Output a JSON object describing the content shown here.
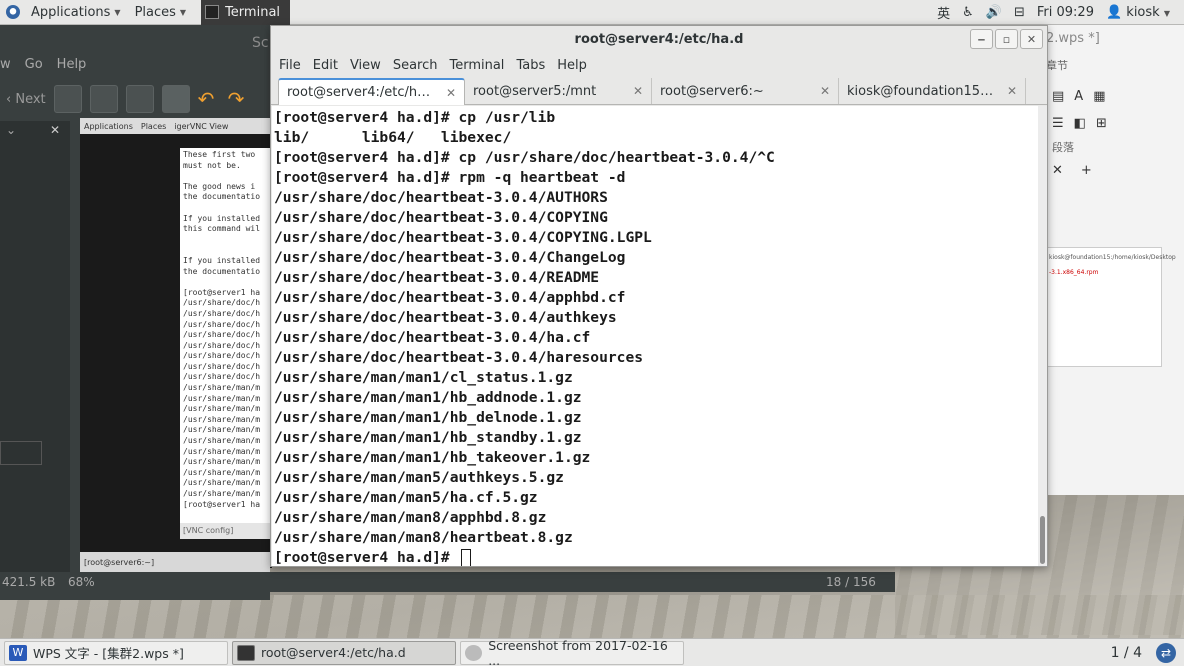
{
  "topbar": {
    "applications": "Applications",
    "places": "Places",
    "terminal_tab": "Terminal",
    "ime": "英",
    "clock": "Fri 09:29",
    "user": "kiosk"
  },
  "background_left": {
    "title": "Sc",
    "menu": [
      "w",
      "Go",
      "Help"
    ],
    "toolbar_next": "Next",
    "file_size": "421.5 kB",
    "zoom": "68%",
    "page": "18 / 156",
    "vnc_bar": [
      "Applications",
      "Places",
      "igerVNC View"
    ],
    "vnc_doc_lines": [
      "These first two",
      "must not be.",
      "",
      "The good news i",
      "the documentatio",
      "",
      "If you installed",
      "this command wil",
      "",
      "",
      "If you installed",
      "the documentatio",
      "",
      "[root@server1 ha",
      "/usr/share/doc/h",
      "/usr/share/doc/h",
      "/usr/share/doc/h",
      "/usr/share/doc/h",
      "/usr/share/doc/h",
      "/usr/share/doc/h",
      "/usr/share/doc/h",
      "/usr/share/doc/h",
      "/usr/share/man/m",
      "/usr/share/man/m",
      "/usr/share/man/m",
      "/usr/share/man/m",
      "/usr/share/man/m",
      "/usr/share/man/m",
      "/usr/share/man/m",
      "/usr/share/man/m",
      "/usr/share/man/m",
      "/usr/share/man/m",
      "/usr/share/man/m",
      "[root@server1 ha"
    ],
    "vnc_config": "[VNC config]",
    "vnc_task": "[root@server6:~]"
  },
  "background_right": {
    "title": "2.wps *]",
    "section": "章节",
    "para": "段落",
    "mini_title": "kiosk@foundation15:/home/kiosk/Desktop",
    "mini_text": "-3.1.x86_64.rpm"
  },
  "terminal": {
    "title": "root@server4:/etc/ha.d",
    "menu": [
      "File",
      "Edit",
      "View",
      "Search",
      "Terminal",
      "Tabs",
      "Help"
    ],
    "tabs": [
      {
        "label": "root@server4:/etc/ha.d",
        "active": true
      },
      {
        "label": "root@server5:/mnt",
        "active": false
      },
      {
        "label": "root@server6:~",
        "active": false
      },
      {
        "label": "kiosk@foundation15:/ho...",
        "active": false
      }
    ],
    "lines": [
      "[root@server4 ha.d]# cp /usr/lib",
      "lib/      lib64/   libexec/",
      "[root@server4 ha.d]# cp /usr/share/doc/heartbeat-3.0.4/^C",
      "[root@server4 ha.d]# rpm -q heartbeat -d",
      "/usr/share/doc/heartbeat-3.0.4/AUTHORS",
      "/usr/share/doc/heartbeat-3.0.4/COPYING",
      "/usr/share/doc/heartbeat-3.0.4/COPYING.LGPL",
      "/usr/share/doc/heartbeat-3.0.4/ChangeLog",
      "/usr/share/doc/heartbeat-3.0.4/README",
      "/usr/share/doc/heartbeat-3.0.4/apphbd.cf",
      "/usr/share/doc/heartbeat-3.0.4/authkeys",
      "/usr/share/doc/heartbeat-3.0.4/ha.cf",
      "/usr/share/doc/heartbeat-3.0.4/haresources",
      "/usr/share/man/man1/cl_status.1.gz",
      "/usr/share/man/man1/hb_addnode.1.gz",
      "/usr/share/man/man1/hb_delnode.1.gz",
      "/usr/share/man/man1/hb_standby.1.gz",
      "/usr/share/man/man1/hb_takeover.1.gz",
      "/usr/share/man/man5/authkeys.5.gz",
      "/usr/share/man/man5/ha.cf.5.gz",
      "/usr/share/man/man8/apphbd.8.gz",
      "/usr/share/man/man8/heartbeat.8.gz"
    ],
    "prompt": "[root@server4 ha.d]# "
  },
  "taskbar": {
    "tasks": [
      {
        "label": "WPS 文字 - [集群2.wps *]",
        "icon": "wps-icon",
        "active": false
      },
      {
        "label": "root@server4:/etc/ha.d",
        "icon": "terminal-icon",
        "active": true
      },
      {
        "label": "Screenshot from 2017-02-16 ...",
        "icon": "screenshot-icon",
        "active": false
      }
    ],
    "workspace": "1 / 4"
  }
}
